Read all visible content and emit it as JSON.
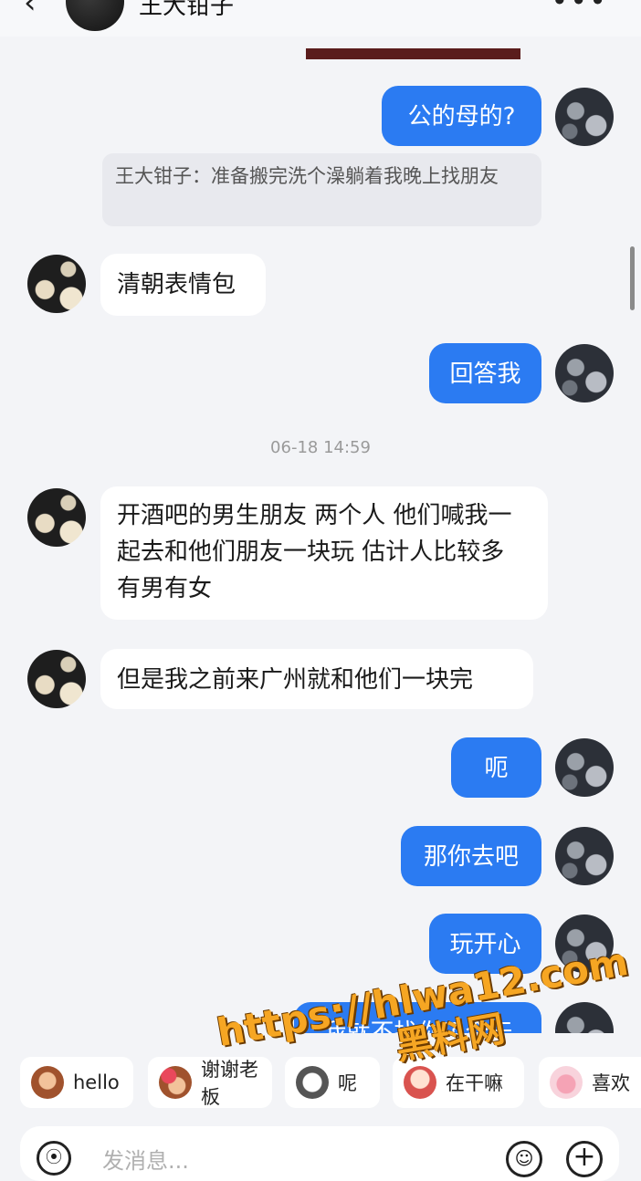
{
  "header": {
    "back_icon": "chevron-left-icon",
    "title": "王大钳子",
    "more_icon": "more-horizontal-icon"
  },
  "quote": {
    "text": "王大钳子：准备搬完洗个澡躺着我晚上找朋友"
  },
  "timestamp": "06-18 14:59",
  "messages": [
    {
      "from": "me",
      "text": "公的母的?"
    },
    {
      "from": "them",
      "text": "清朝表情包"
    },
    {
      "from": "me",
      "text": "回答我"
    },
    {
      "from": "them",
      "text": "开酒吧的男生朋友 两个人 他们喊我一起去和他们朋友一块玩 估计人比较多 有男有女"
    },
    {
      "from": "them",
      "text": "但是我之前来广州就和他们一块完"
    },
    {
      "from": "me",
      "text": "呃"
    },
    {
      "from": "me",
      "text": "那你去吧"
    },
    {
      "from": "me",
      "text": "玩开心"
    },
    {
      "from": "me",
      "text": "我就不找你了今天"
    }
  ],
  "quick_replies": [
    {
      "label": "hello",
      "icon": "monkey-emoji-icon"
    },
    {
      "label": "谢谢老板",
      "icon": "flower-monkey-emoji-icon"
    },
    {
      "label": "呢",
      "icon": "sticker-emoji-icon"
    },
    {
      "label": "在干嘛",
      "icon": "cartoon-emoji-icon"
    },
    {
      "label": "喜欢",
      "icon": "pig-emoji-icon"
    }
  ],
  "input": {
    "placeholder": "发消息..."
  },
  "watermark": {
    "url": "https://hlwa12.com",
    "sub": "黑料网"
  },
  "colors": {
    "my_bubble": "#2b7bf2",
    "their_bubble": "#ffffff",
    "background": "#f3f4f7",
    "watermark": "#f6a623"
  }
}
